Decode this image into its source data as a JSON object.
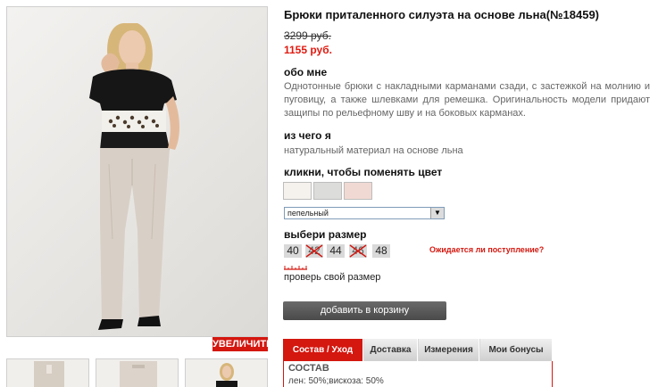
{
  "gallery": {
    "zoom_label": "УВЕЛИЧИТЬ"
  },
  "product": {
    "title": "Брюки приталенного силуэта на основе льна(№18459)",
    "old_price": "3299 руб.",
    "new_price": "1155 руб."
  },
  "about": {
    "heading": "обо мне",
    "text": "Однотонные брюки с накладными карманами сзади, с застежкой на молнию и пуговицу, а также шлевками для ремешка. Оригинальность модели придают защипы по рельефному шву и на боковых карманах."
  },
  "material": {
    "heading": "из чего я",
    "text": "натуральный материал на основе льна"
  },
  "colors": {
    "heading": "кликни, чтобы поменять цвет",
    "swatches": [
      {
        "color": "#f5f1ec"
      },
      {
        "color": "#dcdcda"
      },
      {
        "color": "#f1d9d3"
      }
    ],
    "selected": "пепельный"
  },
  "sizes": {
    "heading": "выбери размер",
    "items": [
      {
        "label": "40",
        "available": true
      },
      {
        "label": "42",
        "available": false
      },
      {
        "label": "44",
        "available": true
      },
      {
        "label": "46",
        "available": false
      },
      {
        "label": "48",
        "available": true
      }
    ],
    "await_link": "Ожидается ли поступление?",
    "check_size": "проверь свой размер"
  },
  "cart": {
    "add_label": "добавить в корзину"
  },
  "tabs": {
    "items": [
      {
        "label": "Состав / Уход"
      },
      {
        "label": "Доставка"
      },
      {
        "label": "Измерения"
      },
      {
        "label": "Мои бонусы"
      }
    ],
    "panel": {
      "heading": "СОСТАВ",
      "text": "лен: 50%;вискоза: 50%"
    }
  },
  "theme": {
    "accent": "#d4170f",
    "price_red": "#e01a10",
    "button_gray": "#555555"
  }
}
